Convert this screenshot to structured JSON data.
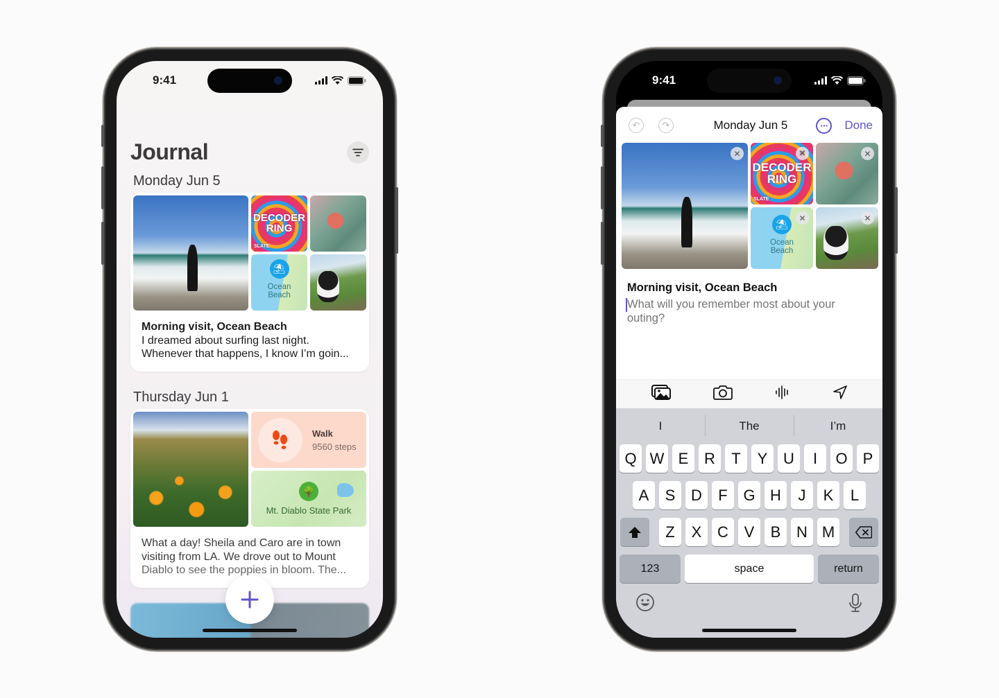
{
  "left_phone": {
    "status": {
      "time": "9:41"
    },
    "header": {
      "title": "Journal",
      "filter_icon": "line-3-horizontal-decrease-icon"
    },
    "sections": [
      {
        "day": "Monday",
        "date": "Jun 5",
        "card": {
          "tiles": [
            {
              "type": "photo",
              "description": "Person in wetsuit at ocean beach"
            },
            {
              "type": "podcast",
              "title_line1": "DECODER",
              "title_line2": "RING",
              "publisher": "SLATE"
            },
            {
              "type": "photo",
              "description": "Scallop shell on towel"
            },
            {
              "type": "location",
              "label_line1": "Ocean",
              "label_line2": "Beach",
              "icon": "beach-umbrella-icon"
            },
            {
              "type": "photo",
              "description": "Dog looking out car window"
            }
          ],
          "title": "Morning visit, Ocean Beach",
          "line1": "I dreamed about surfing last night.",
          "line2": "Whenever that happens, I know I’m goin..."
        }
      },
      {
        "day": "Thursday",
        "date": "Jun 1",
        "card": {
          "tiles": [
            {
              "type": "photo",
              "description": "Poppies on a hillside"
            },
            {
              "type": "workout",
              "label": "Walk",
              "value": "9560 steps",
              "icon": "footprints-icon"
            },
            {
              "type": "location",
              "label": "Mt. Diablo State Park",
              "icon": "tree-icon"
            }
          ],
          "line1": "What a day! Sheila and Caro are in town",
          "line2": "visiting from LA. We drove out to Mount",
          "line3": "Diablo to see the poppies in bloom. The..."
        }
      }
    ],
    "fab": {
      "icon": "plus-icon",
      "label": "New entry"
    }
  },
  "right_phone": {
    "status": {
      "time": "9:41"
    },
    "nav": {
      "undo_icon": "undo-icon",
      "redo_icon": "redo-icon",
      "title": "Monday Jun 5",
      "more_icon": "ellipsis-circle-icon",
      "done_label": "Done"
    },
    "attachments": [
      {
        "type": "photo",
        "description": "Person in wetsuit at ocean beach"
      },
      {
        "type": "podcast",
        "title_line1": "DECODER",
        "title_line2": "RING",
        "publisher": "SLATE"
      },
      {
        "type": "photo",
        "description": "Scallop shell on towel"
      },
      {
        "type": "location",
        "label_line1": "Ocean",
        "label_line2": "Beach"
      },
      {
        "type": "photo",
        "description": "Dog looking out car window"
      }
    ],
    "entry": {
      "title": "Morning visit, Ocean Beach",
      "body_value": "",
      "body_placeholder": "What will you remember most about your outing?"
    },
    "toolbar": [
      {
        "name": "photo-library-icon"
      },
      {
        "name": "camera-icon"
      },
      {
        "name": "audio-waveform-icon"
      },
      {
        "name": "location-arrow-icon"
      }
    ],
    "keyboard": {
      "suggestions": [
        "I",
        "The",
        "I’m"
      ],
      "row1": [
        "Q",
        "W",
        "E",
        "R",
        "T",
        "Y",
        "U",
        "I",
        "O",
        "P"
      ],
      "row2": [
        "A",
        "S",
        "D",
        "F",
        "G",
        "H",
        "J",
        "K",
        "L"
      ],
      "row3": [
        "Z",
        "X",
        "C",
        "V",
        "B",
        "N",
        "M"
      ],
      "numbers_label": "123",
      "space_label": "space",
      "return_label": "return"
    }
  },
  "colors": {
    "accent": "#5f55c9",
    "walk_tile": "#fdd9cc",
    "walk_icon": "#f04a14",
    "park_pin": "#4caf3a",
    "beach_pin": "#1aa3e8",
    "keyboard_bg": "#d1d3d9"
  }
}
